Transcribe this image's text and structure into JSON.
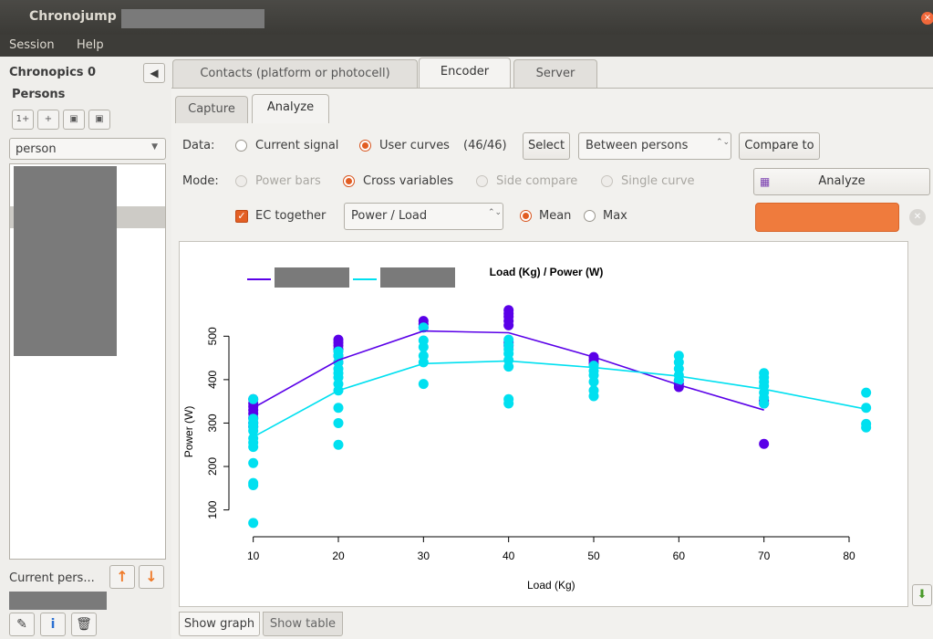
{
  "window": {
    "title": "Chronojump –",
    "close_glyph": "×"
  },
  "menu": [
    "Session",
    "Help"
  ],
  "left": {
    "chronopics_label": "Chronopics 0",
    "persons_label": "Persons",
    "person_buttons": [
      "1+",
      "+",
      "▣",
      "▣"
    ],
    "person_combo_value": "person",
    "current_person_label": "Current pers...",
    "up_glyph": "↑",
    "down_glyph": "↓"
  },
  "tabs": [
    "Contacts (platform or photocell)",
    "Encoder",
    "Server"
  ],
  "subtabs": [
    "Capture",
    "Analyze"
  ],
  "analyze": {
    "data_label": "Data:",
    "current_signal": "Current signal",
    "user_curves": "User curves",
    "curves_count": "(46/46)",
    "select_button": "Select",
    "between_combo": "Between persons",
    "compare_button": "Compare to",
    "mode_label": "Mode:",
    "modes": [
      "Power bars",
      "Cross variables",
      "Side compare",
      "Single curve"
    ],
    "analyze_button": "Analyze",
    "ec_together": "EC together",
    "variables_combo": "Power / Load",
    "mean_label": "Mean",
    "max_label": "Max"
  },
  "bottom_tabs": [
    "Show graph",
    "Show table"
  ],
  "colors": {
    "accent": "#e25d22",
    "series1": "#5a00e8",
    "series2": "#00e0f0"
  },
  "chart_data": {
    "type": "scatter",
    "title": "Load (Kg) / Power (W)",
    "xlabel": "Load (Kg)",
    "ylabel": "Power (W)",
    "x_ticks": [
      10,
      20,
      30,
      40,
      50,
      60,
      70,
      80
    ],
    "y_ticks": [
      100,
      200,
      300,
      400,
      500
    ],
    "xlim": [
      8,
      83
    ],
    "ylim": [
      55,
      570
    ],
    "series": [
      {
        "color": "#5a00e8",
        "points": [
          [
            10,
            355
          ],
          [
            10,
            345
          ],
          [
            10,
            338
          ],
          [
            10,
            330
          ],
          [
            10,
            322
          ],
          [
            10,
            312
          ],
          [
            10,
            300
          ],
          [
            10,
            292
          ],
          [
            20,
            492
          ],
          [
            20,
            485
          ],
          [
            20,
            478
          ],
          [
            20,
            470
          ],
          [
            20,
            455
          ],
          [
            20,
            440
          ],
          [
            30,
            535
          ],
          [
            30,
            528
          ],
          [
            30,
            520
          ],
          [
            40,
            560
          ],
          [
            40,
            552
          ],
          [
            40,
            545
          ],
          [
            40,
            535
          ],
          [
            40,
            525
          ],
          [
            40,
            485
          ],
          [
            40,
            478
          ],
          [
            50,
            452
          ],
          [
            50,
            445
          ],
          [
            50,
            438
          ],
          [
            60,
            398
          ],
          [
            60,
            390
          ],
          [
            60,
            383
          ],
          [
            70,
            352
          ],
          [
            70,
            345
          ],
          [
            70,
            252
          ]
        ],
        "line": [
          [
            10,
            335
          ],
          [
            20,
            445
          ],
          [
            30,
            512
          ],
          [
            40,
            508
          ],
          [
            50,
            452
          ],
          [
            60,
            388
          ],
          [
            70,
            330
          ]
        ]
      },
      {
        "color": "#00e0f0",
        "points": [
          [
            10,
            355
          ],
          [
            10,
            310
          ],
          [
            10,
            300
          ],
          [
            10,
            292
          ],
          [
            10,
            282
          ],
          [
            10,
            265
          ],
          [
            10,
            255
          ],
          [
            10,
            245
          ],
          [
            10,
            208
          ],
          [
            10,
            162
          ],
          [
            10,
            157
          ],
          [
            10,
            70
          ],
          [
            20,
            465
          ],
          [
            20,
            455
          ],
          [
            20,
            440
          ],
          [
            20,
            425
          ],
          [
            20,
            415
          ],
          [
            20,
            405
          ],
          [
            20,
            390
          ],
          [
            20,
            375
          ],
          [
            20,
            335
          ],
          [
            20,
            300
          ],
          [
            20,
            250
          ],
          [
            30,
            520
          ],
          [
            30,
            490
          ],
          [
            30,
            475
          ],
          [
            30,
            455
          ],
          [
            30,
            440
          ],
          [
            30,
            390
          ],
          [
            40,
            492
          ],
          [
            40,
            480
          ],
          [
            40,
            470
          ],
          [
            40,
            460
          ],
          [
            40,
            445
          ],
          [
            40,
            430
          ],
          [
            40,
            355
          ],
          [
            40,
            345
          ],
          [
            50,
            432
          ],
          [
            50,
            420
          ],
          [
            50,
            410
          ],
          [
            50,
            395
          ],
          [
            50,
            375
          ],
          [
            50,
            362
          ],
          [
            60,
            455
          ],
          [
            60,
            440
          ],
          [
            60,
            425
          ],
          [
            60,
            410
          ],
          [
            60,
            398
          ],
          [
            70,
            415
          ],
          [
            70,
            405
          ],
          [
            70,
            395
          ],
          [
            70,
            385
          ],
          [
            70,
            370
          ],
          [
            70,
            358
          ],
          [
            70,
            345
          ],
          [
            82,
            370
          ],
          [
            82,
            335
          ],
          [
            82,
            298
          ],
          [
            82,
            290
          ]
        ],
        "line": [
          [
            10,
            268
          ],
          [
            20,
            375
          ],
          [
            30,
            437
          ],
          [
            40,
            443
          ],
          [
            50,
            428
          ],
          [
            60,
            408
          ],
          [
            70,
            378
          ],
          [
            82,
            332
          ]
        ]
      }
    ]
  }
}
